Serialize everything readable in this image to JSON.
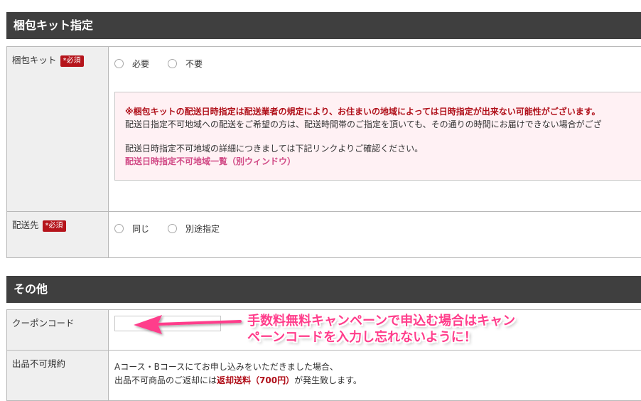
{
  "section1": {
    "title": "梱包キット指定",
    "rows": {
      "kit": {
        "label": "梱包キット",
        "required": "*必須",
        "options": [
          "必要",
          "不要"
        ]
      },
      "destination": {
        "label": "配送先",
        "required": "*必須",
        "options": [
          "同じ",
          "別途指定"
        ]
      }
    },
    "notice": {
      "warning": "※梱包キットの配送日時指定は配送業者の規定により、お住まいの地域によっては日時指定が出来ない可能性がございます。",
      "line2": "配送日指定不可地域への配送をご希望の方は、配送時間帯のご指定を頂いても、その通りの時間にお届けできない場合がござ",
      "line3": "配送日時指定不可地域の詳細につきましては下記リンクよりご確認ください。",
      "link": "配送日時指定不可地域一覧（別ウィンドウ）"
    }
  },
  "section2": {
    "title": "その他",
    "coupon": {
      "label": "クーポンコード",
      "value": "",
      "placeholder": ""
    },
    "terms": {
      "label": "出品不可規約",
      "line1": "Aコース・Bコースにてお申し込みをいただきました場合、",
      "line2_prefix": "出品不可商品のご返却には",
      "line2_red": "返却送料（700円）",
      "line2_suffix": "が発生致します。"
    }
  },
  "annotation": {
    "line1": "手数料無料キャンペーンで申込む場合はキャン",
    "line2": "ペーンコードを入力し忘れないように！"
  },
  "colors": {
    "header_bg": "#3f3f3f",
    "required_badge": "#b5141b",
    "notice_bg": "#fff1f4",
    "annotation": "#ff3d8b"
  }
}
